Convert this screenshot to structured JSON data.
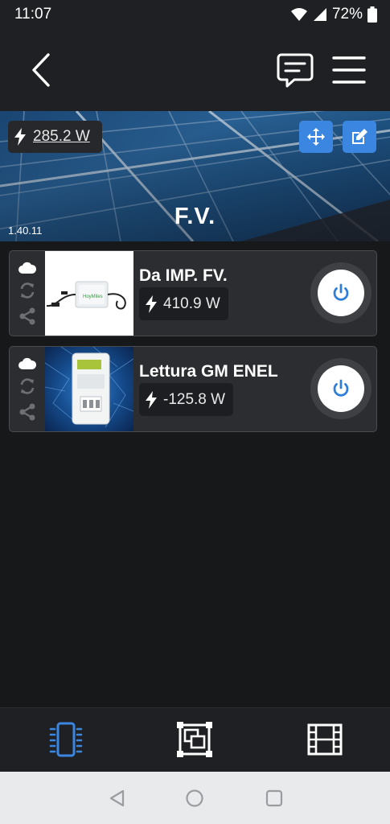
{
  "status_bar": {
    "time": "11:07",
    "battery": "72%"
  },
  "header": {
    "back_icon": "chevron-left-icon",
    "messages_icon": "message-icon",
    "menu_icon": "hamburger-menu-icon"
  },
  "hero": {
    "total_power": "285.2 W",
    "title": "F.V.",
    "version": "1.40.11",
    "move_icon": "move-arrows-icon",
    "edit_icon": "edit-icon"
  },
  "devices": [
    {
      "name": "Da IMP. FV.",
      "power": "410.9 W"
    },
    {
      "name": "Lettura GM ENEL",
      "power": "-125.8 W"
    }
  ],
  "tabs": [
    {
      "icon": "device-chip-icon",
      "active": true
    },
    {
      "icon": "rooms-icon",
      "active": false
    },
    {
      "icon": "scenes-film-icon",
      "active": false
    }
  ],
  "colors": {
    "accent": "#3b86e0",
    "background": "#17181a",
    "surface": "#2b2d31"
  }
}
